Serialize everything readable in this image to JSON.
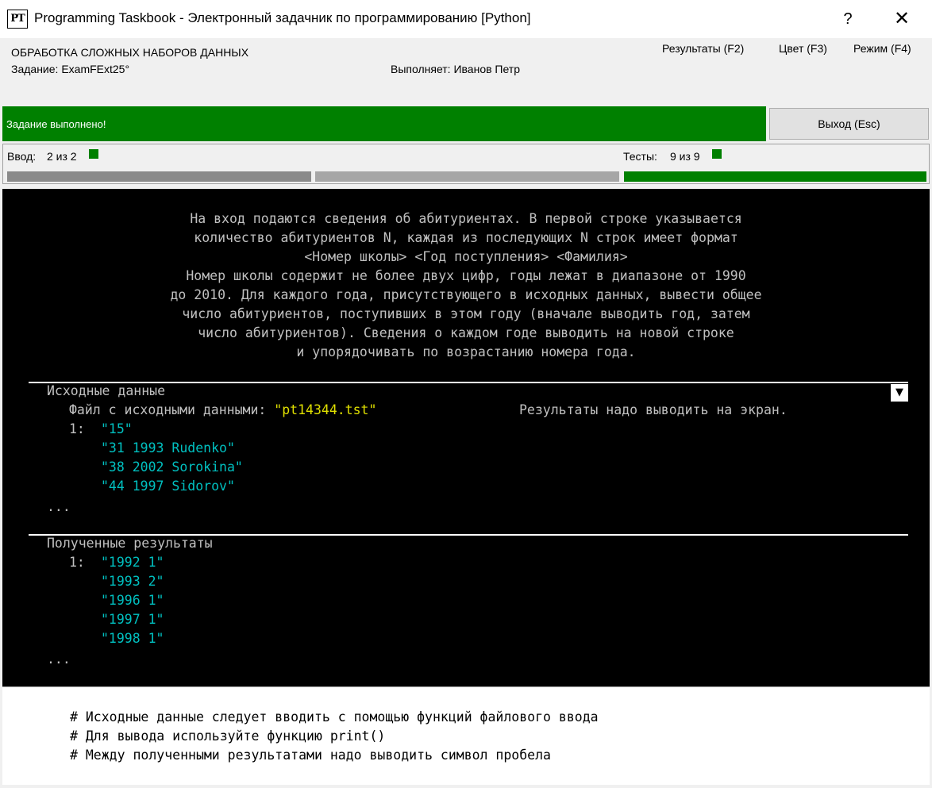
{
  "window": {
    "icon_text": "PT",
    "title": "Programming Taskbook - Электронный задачник по программированию [Python]",
    "help": "?",
    "close": "✕"
  },
  "header": {
    "group": "ОБРАБОТКА СЛОЖНЫХ НАБОРОВ ДАННЫХ",
    "task": "Задание: ExamFExt25°",
    "performer": "Выполняет: Иванов Петр",
    "menu": {
      "results": "Результаты (F2)",
      "color": "Цвет (F3)",
      "mode": "Режим (F4)"
    }
  },
  "status": {
    "message": "Задание выполнено!",
    "exit_label": "Выход (Esc)",
    "status_color": "#008000"
  },
  "progress": {
    "input_label": "Ввод:",
    "input_value": "2 из 2",
    "tests_label": "Тесты:",
    "tests_value": "9 из 9",
    "tests_fraction": 1.0
  },
  "task_text": [
    "На вход подаются сведения об абитуриентах. В первой строке указывается",
    "количество абитуриентов N, каждая из последующих N строк имеет формат",
    "<Номер школы> <Год поступления> <Фамилия>",
    "Номер школы содержит не более двух цифр, годы лежат в диапазоне от 1990",
    "до 2010. Для каждого года, присутствующего в исходных данных, вывести общее",
    "число абитуриентов, поступивших в этом году (вначале выводить год, затем",
    "число абитуриентов). Сведения о каждом годе выводить на новой строке",
    "и упорядочивать по возрастанию номера года."
  ],
  "input_section": {
    "title": "Исходные данные",
    "scroll_icon": "▼",
    "file_prefix": "Файл с исходными данными: ",
    "file_name": "\"pt14344.tst\"",
    "output_note": "Результаты надо выводить на экран.",
    "line_no": "1:",
    "lines": [
      "\"15\"",
      "\"31 1993 Rudenko\"",
      "\"38 2002 Sorokina\"",
      "\"44 1997 Sidorov\""
    ],
    "ellipsis": "..."
  },
  "output_section": {
    "title": "Полученные результаты",
    "line_no": "1:",
    "lines": [
      "\"1992 1\"",
      "\"1993 2\"",
      "\"1996 1\"",
      "\"1997 1\"",
      "\"1998 1\""
    ],
    "ellipsis": "..."
  },
  "notes": [
    "# Исходные данные следует вводить с помощью функций файлового ввода",
    "# Для вывода используйте функцию print()",
    "# Между полученными результатами надо выводить символ пробела"
  ]
}
